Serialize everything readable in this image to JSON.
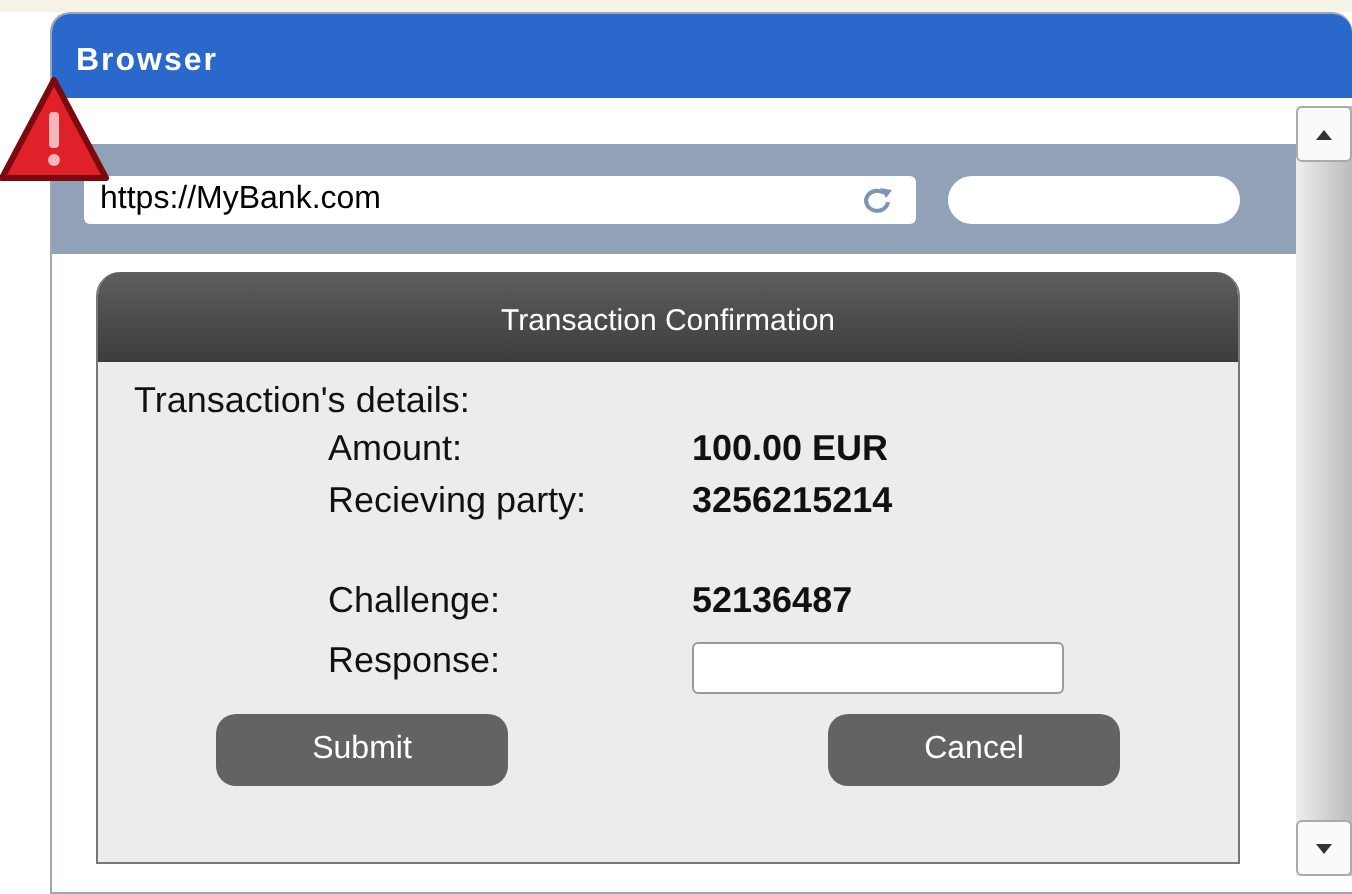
{
  "window": {
    "title": "Browser"
  },
  "address_bar": {
    "value": "https://MyBank.com"
  },
  "dialog": {
    "title": "Transaction Confirmation",
    "heading": "Transaction's details:",
    "fields": [
      {
        "label": "Amount:",
        "value": "100.00 EUR"
      },
      {
        "label": "Recieving party:",
        "value": "3256215214"
      }
    ],
    "challenge": {
      "label": "Challenge:",
      "value": "52136487"
    },
    "response": {
      "label": "Response:"
    },
    "buttons": [
      "Submit",
      "Cancel"
    ]
  }
}
